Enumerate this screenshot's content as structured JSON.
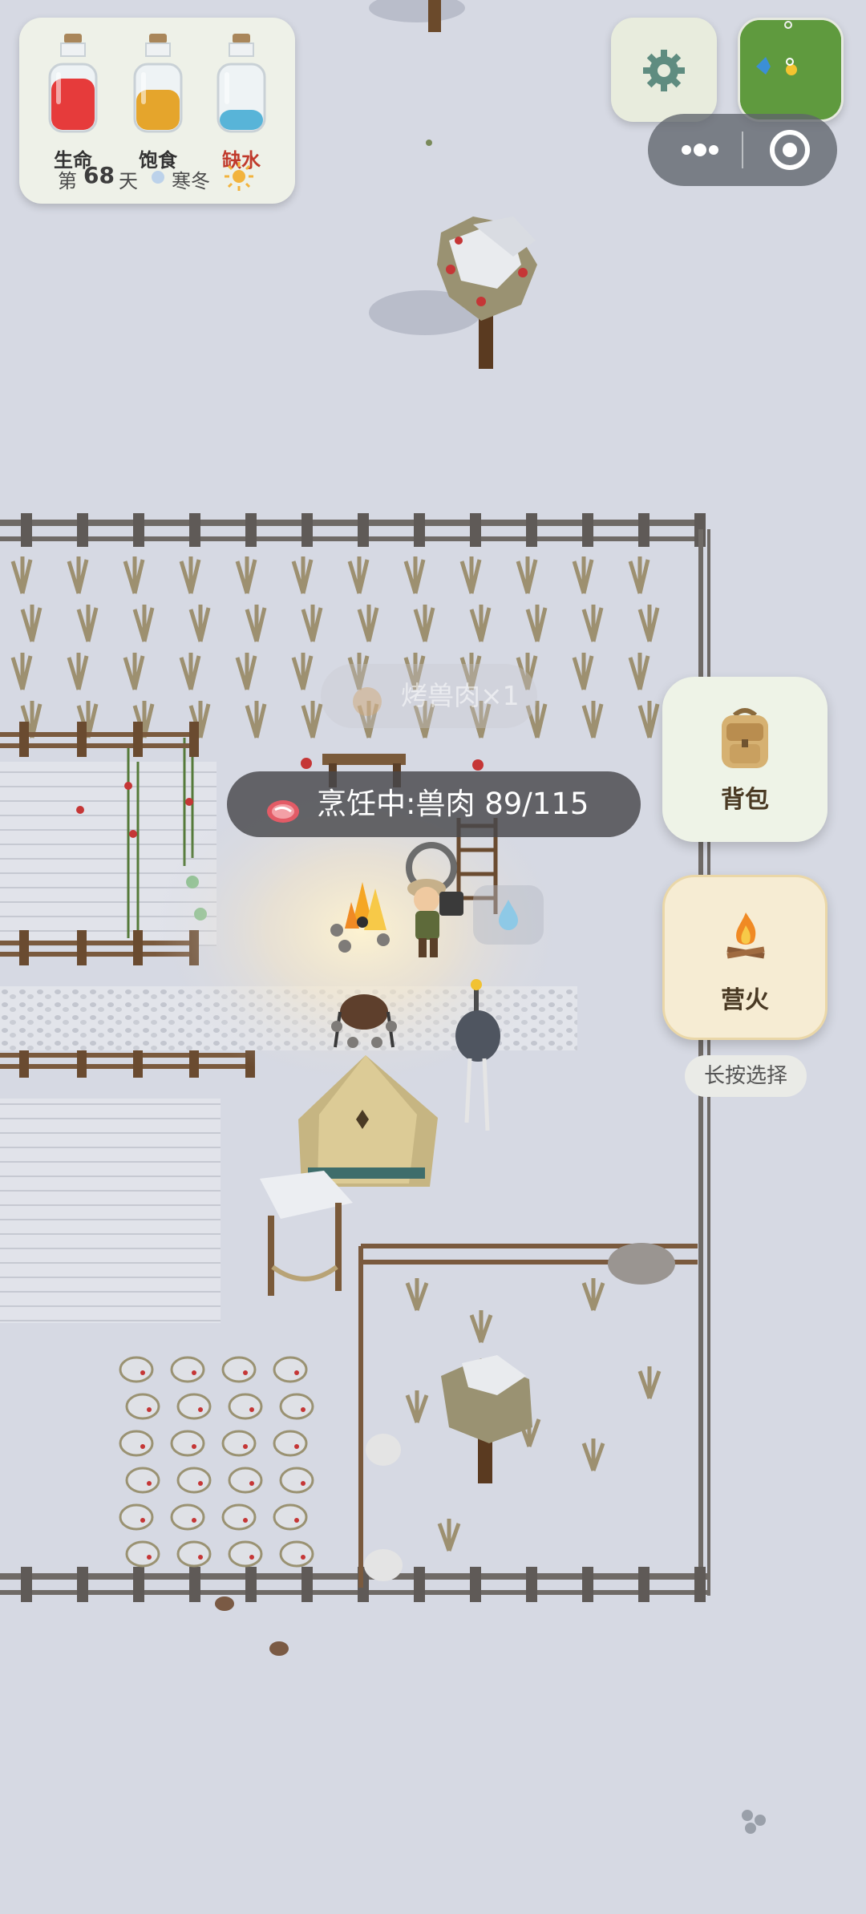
{
  "status": {
    "bars": [
      {
        "label": "生命",
        "fill_fraction": 0.78,
        "color": "#e63b3b",
        "label_color": "#333333"
      },
      {
        "label": "饱食",
        "fill_fraction": 0.62,
        "color": "#e5a52c",
        "label_color": "#333333"
      },
      {
        "label": "缺水",
        "fill_fraction": 0.32,
        "color": "#58b4d8",
        "label_color": "#c0392b"
      }
    ],
    "day_prefix": "第",
    "day_number": "68",
    "day_suffix": "天",
    "season": "寒冬",
    "season_icon": "snowflake-dot-icon",
    "weather_icon": "sun-icon"
  },
  "toolbar": {
    "settings_icon": "gear-icon",
    "minimap_label": "minimap",
    "menu_icon": "more-dots-icon",
    "close_icon": "target-circle-icon"
  },
  "side_buttons": {
    "backpack_label": "背包",
    "backpack_icon": "backpack-icon",
    "campfire_label": "营火",
    "campfire_icon": "campfire-icon",
    "campfire_hint": "长按选择"
  },
  "cooking": {
    "icon": "raw-meat-icon",
    "status_text": "烹饪中:兽肉 89/115",
    "item_name": "兽肉",
    "progress_current": 89,
    "progress_total": 115,
    "ghost_text": "烤兽肉×1",
    "water_icon": "water-drop-icon"
  },
  "colors": {
    "snow": "#d6d9e3",
    "fence": "#6f6a66",
    "panel": "#eef1e8",
    "accent_campfire": "#f6ecd3"
  }
}
